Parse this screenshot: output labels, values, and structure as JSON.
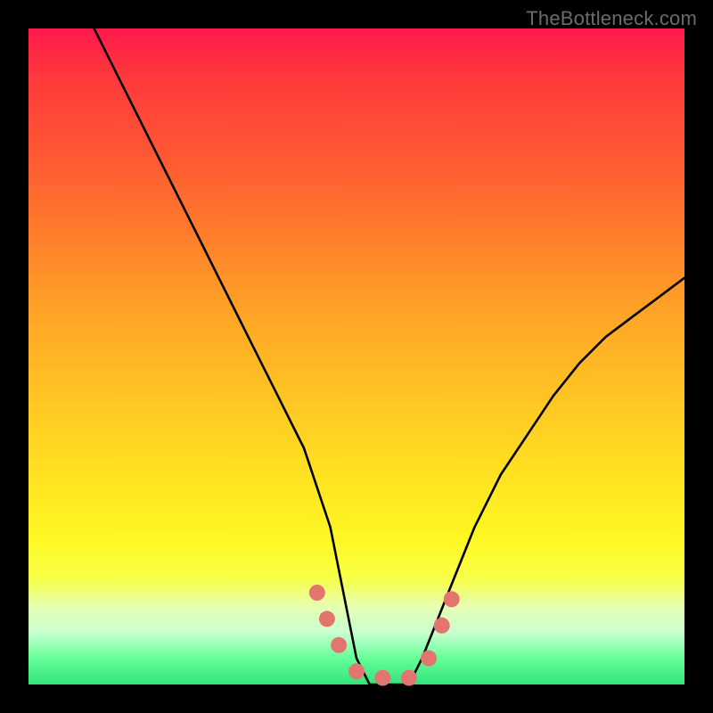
{
  "watermark": "TheBottleneck.com",
  "chart_data": {
    "type": "line",
    "title": "",
    "xlabel": "",
    "ylabel": "",
    "xlim": [
      0,
      100
    ],
    "ylim": [
      0,
      100
    ],
    "series": [
      {
        "name": "bottleneck-curve",
        "x": [
          10,
          14,
          18,
          22,
          26,
          30,
          34,
          38,
          42,
          46,
          48,
          50,
          52,
          54,
          56,
          58,
          60,
          64,
          68,
          72,
          76,
          80,
          84,
          88,
          92,
          96,
          100
        ],
        "values": [
          100,
          92,
          84,
          76,
          68,
          60,
          52,
          44,
          36,
          24,
          14,
          4,
          0,
          0,
          0,
          0,
          4,
          14,
          24,
          32,
          38,
          44,
          49,
          53,
          56,
          59,
          62
        ]
      }
    ],
    "markers": {
      "name": "curve-dots",
      "shape": "circle",
      "color": "#e2766e",
      "x": [
        44,
        45.5,
        47.3,
        50,
        54,
        58,
        61,
        63,
        64.5
      ],
      "values": [
        14,
        10,
        6,
        2,
        1,
        1,
        4,
        9,
        13
      ]
    },
    "background_gradient": {
      "top": "#ff1a4d",
      "bottom": "#33e37a"
    }
  }
}
